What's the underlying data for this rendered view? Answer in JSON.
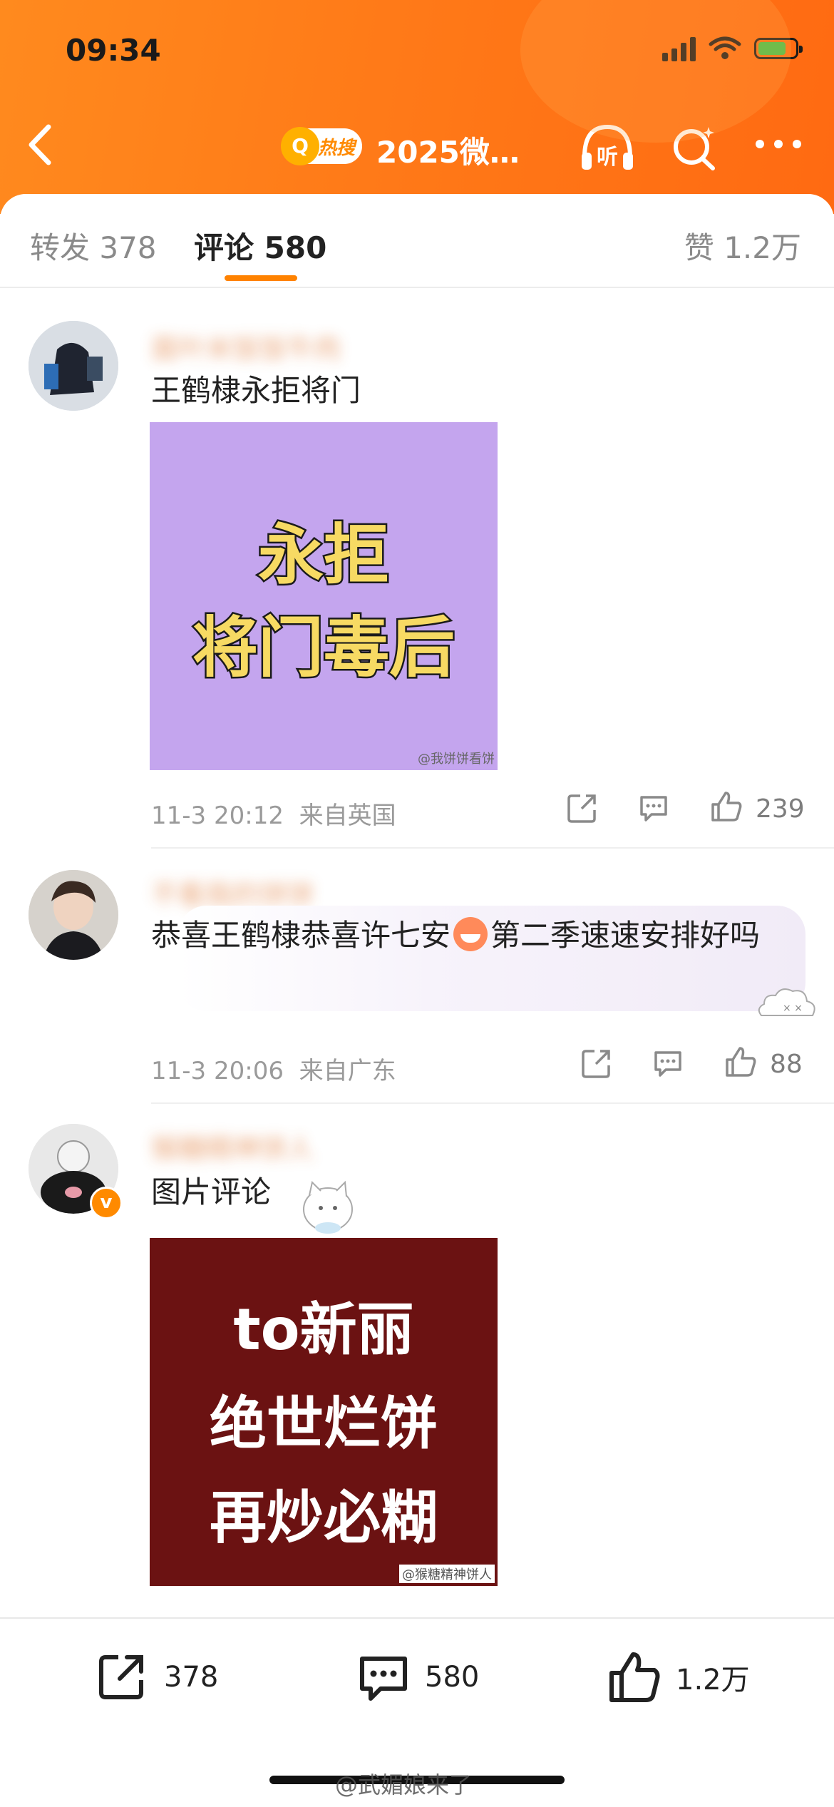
{
  "status_bar": {
    "time": "09:34"
  },
  "nav": {
    "hot_badge": "热搜",
    "title": "2025微…",
    "listen_label": "听"
  },
  "tabs": {
    "repost": "转发 378",
    "comments": "评论 580",
    "likes": "赞 1.2万"
  },
  "comments": [
    {
      "username": "面叶米饭饭牛肉",
      "text": "王鹤棣永拒将门",
      "image_lines": [
        "永拒",
        "将门毒后"
      ],
      "image_watermark": "@我饼饼看饼",
      "time": "11-3 20:12",
      "location": "来自英国",
      "likes": "239"
    },
    {
      "username": "不看我的饼饼",
      "text": "恭喜王鹤棣恭喜许七安",
      "text_after_emoji": "第二季速速安排好吗",
      "time": "11-3 20:06",
      "location": "来自广东",
      "likes": "88"
    },
    {
      "username": "猴糖精神饼人",
      "text": "图片评论",
      "image_lines": [
        "to新丽",
        "绝世烂饼",
        "再炒必糊"
      ],
      "image_watermark": "@猴糖精神饼人"
    }
  ],
  "bottom_bar": {
    "repost_count": "378",
    "comment_count": "580",
    "like_count": "1.2万"
  },
  "watermark": "@武媚娘来了",
  "colors": {
    "header_orange": "#ff7a18",
    "tab_underline": "#ff8200",
    "image1_bg": "#c4a5ee",
    "image1_text": "#f7da63",
    "image2_bg": "#6b1212"
  }
}
